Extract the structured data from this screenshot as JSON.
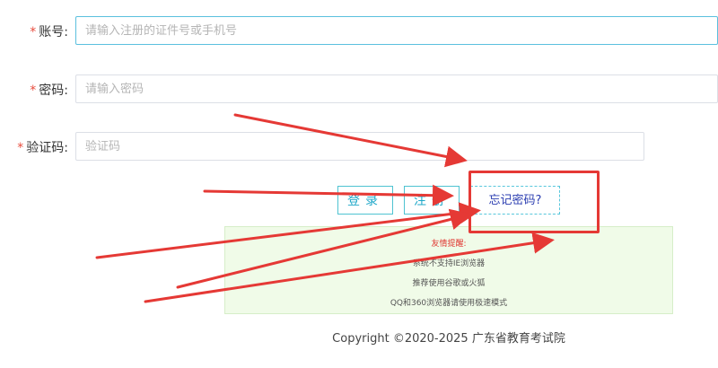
{
  "form": {
    "required_mark": "*",
    "account": {
      "label": "账号:",
      "placeholder": "请输入注册的证件号或手机号",
      "value": ""
    },
    "password": {
      "label": "密码:",
      "placeholder": "请输入密码",
      "value": ""
    },
    "captcha": {
      "label": "验证码:",
      "placeholder": "验证码",
      "value": ""
    }
  },
  "buttons": {
    "login": "登录",
    "register": "注册",
    "forgot": "忘记密码?"
  },
  "tips": {
    "title": "友情提醒:",
    "lines": [
      "系统不支持IE浏览器",
      "推荐使用谷歌或火狐",
      "QQ和360浏览器请使用极速模式"
    ]
  },
  "footer": {
    "copyright": "Copyright ©2020-2025 广东省教育考试院"
  },
  "colors": {
    "accent": "#20a8c9",
    "required": "#e84c3d",
    "annotation": "#e53935",
    "tips_bg": "#f0fbe8"
  }
}
